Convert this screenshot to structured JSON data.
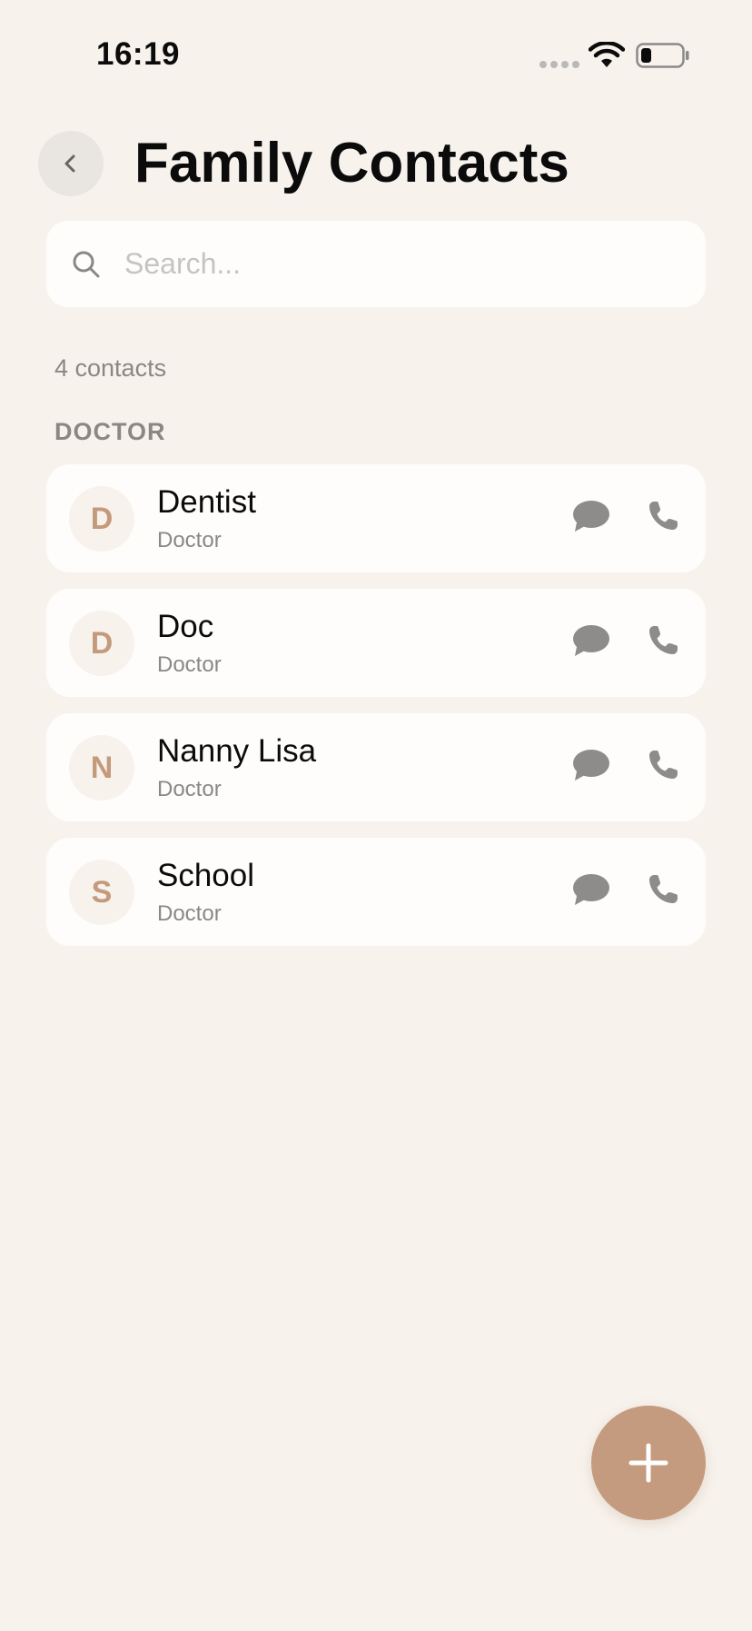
{
  "status_bar": {
    "time": "16:19"
  },
  "header": {
    "back_icon": "chevron-left-icon",
    "title": "Family Contacts"
  },
  "search": {
    "placeholder": "Search...",
    "value": "",
    "icon": "search-icon"
  },
  "summary": {
    "count_label": "4 contacts"
  },
  "sections": [
    {
      "title": "DOCTOR",
      "contacts": [
        {
          "initial": "D",
          "name": "Dentist",
          "role": "Doctor"
        },
        {
          "initial": "D",
          "name": "Doc",
          "role": "Doctor"
        },
        {
          "initial": "N",
          "name": "Nanny Lisa",
          "role": "Doctor"
        },
        {
          "initial": "S",
          "name": "School",
          "role": "Doctor"
        }
      ]
    }
  ],
  "actions": {
    "message_icon": "chat-bubble-icon",
    "call_icon": "phone-icon",
    "add_icon": "plus-icon"
  },
  "colors": {
    "background": "#f7f2ec",
    "card": "#fefdfb",
    "accent": "#c49b7e",
    "muted_text": "#8a8785",
    "icon_gray": "#8e8c8b"
  }
}
